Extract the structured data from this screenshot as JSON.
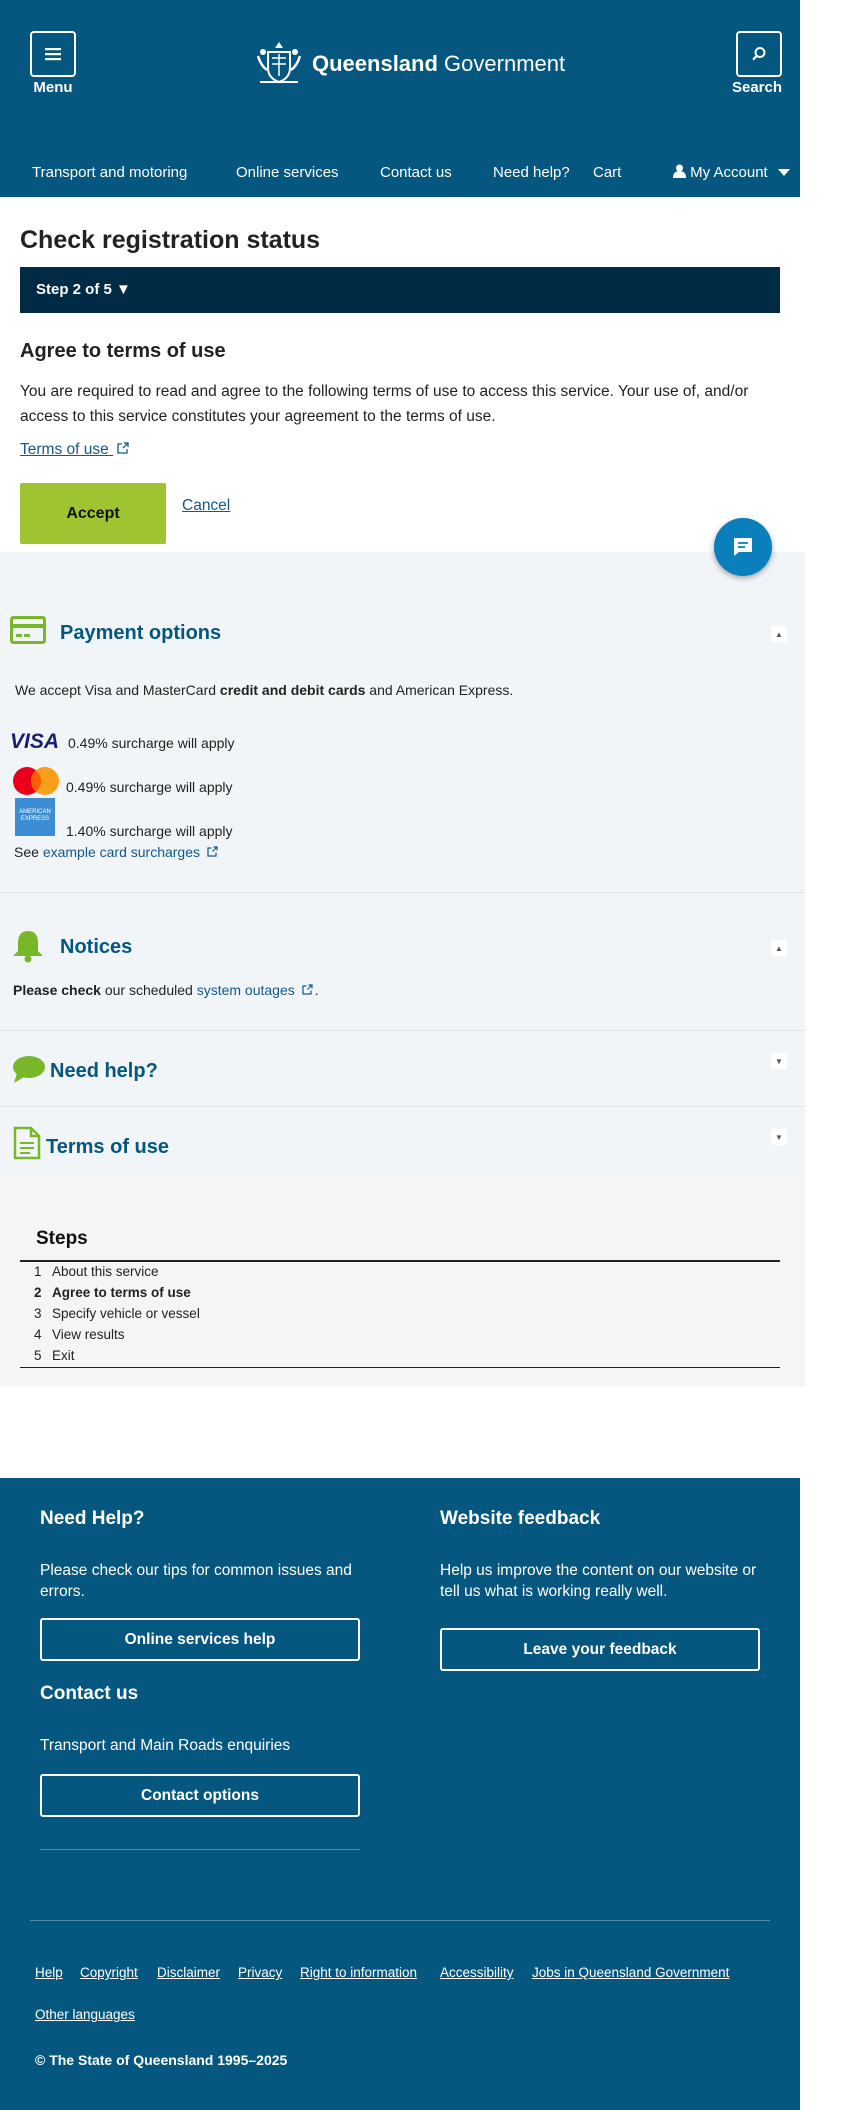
{
  "header": {
    "menu_label": "Menu",
    "search_label": "Search",
    "logo_bold": "Queensland",
    "logo_regular": "Government",
    "nav": {
      "transport": "Transport and motoring",
      "online_services": "Online services",
      "contact": "Contact us",
      "need_help": "Need help?",
      "cart": "Cart",
      "my_account": "My Account"
    }
  },
  "main": {
    "title": "Check registration status",
    "step_indicator": "Step 2 of 5 ▼",
    "heading": "Agree to terms of use",
    "paragraph": "You are required to read and agree to the following terms of use to access this service. Your use of, and/or access to this service constitutes your agreement to the terms of use.",
    "terms_link": "Terms of use",
    "accept_label": "Accept",
    "cancel_label": "Cancel"
  },
  "payment": {
    "title": "Payment options",
    "accept_pre": "We accept Visa and MasterCard ",
    "accept_bold": "credit and debit cards",
    "accept_post": " and American Express.",
    "visa_logo": "VISA",
    "amex_logo": "AMERICAN EXPRESS",
    "visa_surcharge": "0.49% surcharge will apply",
    "mastercard_surcharge": "0.49% surcharge will apply",
    "amex_surcharge": "1.40% surcharge will apply",
    "see_label": "See",
    "surcharge_link": "example card surcharges"
  },
  "notices": {
    "title": "Notices",
    "bold": "Please check",
    "text": " our scheduled ",
    "link": "system outages",
    "end": "."
  },
  "need_help": {
    "title": "Need help?"
  },
  "terms_section": {
    "title": "Terms of use"
  },
  "steps": {
    "title": "Steps",
    "items": [
      {
        "num": "1",
        "label": "About this service"
      },
      {
        "num": "2",
        "label": "Agree to terms of use"
      },
      {
        "num": "3",
        "label": "Specify vehicle or vessel"
      },
      {
        "num": "4",
        "label": "View results"
      },
      {
        "num": "5",
        "label": "Exit"
      }
    ]
  },
  "footer": {
    "need_help_title": "Need Help?",
    "need_help_text": "Please check our tips for common issues and errors.",
    "online_help_btn": "Online services help",
    "feedback_title": "Website feedback",
    "feedback_text": "Help us improve the content on our website or tell us what is working really well.",
    "feedback_btn": "Leave your feedback",
    "contact_title": "Contact us",
    "contact_text": "Transport and Main Roads enquiries",
    "contact_btn": "Contact options",
    "links": {
      "help": "Help",
      "copyright": "Copyright",
      "disclaimer": "Disclaimer",
      "privacy": "Privacy",
      "rti": "Right to information",
      "accessibility": "Accessibility",
      "jobs": "Jobs in Queensland Government",
      "languages": "Other languages"
    },
    "copyright_text": "© The State of Queensland 1995–2025"
  },
  "colors": {
    "brand_blue": "#05577f",
    "step_bar": "#012b44",
    "accept_green": "#9ec431",
    "icon_green": "#78b72a",
    "link_blue": "#13578b"
  }
}
